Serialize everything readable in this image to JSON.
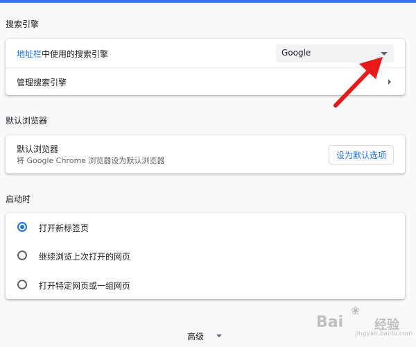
{
  "search_engine": {
    "section_title": "搜索引擎",
    "row1_link": "地址栏",
    "row1_text": "中使用的搜索引擎",
    "selected_engine": "Google",
    "manage_label": "管理搜索引擎"
  },
  "default_browser": {
    "section_title": "默认浏览器",
    "title": "默认浏览器",
    "subtitle": "将 Google Chrome 浏览器设为默认浏览器",
    "button_label": "设为默认选项"
  },
  "startup": {
    "section_title": "启动时",
    "options": [
      {
        "label": "打开新标签页",
        "checked": true
      },
      {
        "label": "继续浏览上次打开的网页",
        "checked": false
      },
      {
        "label": "打开特定网页或一组网页",
        "checked": false
      }
    ]
  },
  "advanced_label": "高级",
  "annotation_arrow_color": "#e8191b",
  "watermark": {
    "text1": "Bai",
    "text2": "经验",
    "text3": "jingyan.baidu.com"
  }
}
